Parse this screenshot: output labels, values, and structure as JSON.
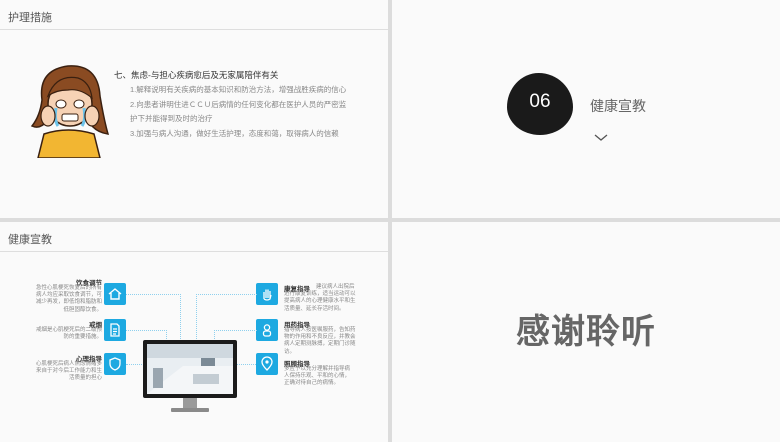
{
  "slide1": {
    "title": "护理措施",
    "heading": "七、焦虑-与担心疾病愈后及无家属陪伴有关",
    "lines": [
      "1.解释说明有关疾病的基本知识和防治方法，增强战胜疾病的信心",
      "2.向患者讲明住进ＣＣＵ后病情的任何变化都在医护人员的严密监",
      "护下并能得到及时的治疗",
      "3.加强与病人沟通，做好生活护理，态度和蔼，取得病人的信赖"
    ]
  },
  "slide2": {
    "number": "06",
    "title": "健康宣教"
  },
  "slide3": {
    "title": "健康宣教",
    "left_items": [
      {
        "title": "饮食调节",
        "body": "急性心肌梗死恢复后的所有\n病人均应采取饮食调节，可\n减少再发，即低饱和脂肪和\n低胆固醇饮食。",
        "icon": "home-icon"
      },
      {
        "title": "戒烟",
        "body": "戒烟是心肌梗死后的二级预\n防的重要措施。",
        "icon": "document-icon"
      },
      {
        "title": "心理指导",
        "body": "心肌梗死后病人焦虑情绪多\n来自于对今后工作能力和生\n活质量的担心",
        "icon": "shield-icon"
      }
    ],
    "right_items": [
      {
        "title": "康复指导",
        "body": "建议病人出院后\n进行康复训练，适当运动可以\n提高病人的心理健康水平和生\n活质量、延长存活时间。",
        "icon": "hand-icon"
      },
      {
        "title": "用药指导",
        "body": "指导病人按医嘱服药，告知药\n物的作用和不良反应，并教会\n病人定期测脉搏，定期门诊随\n访。",
        "icon": "person-icon"
      },
      {
        "title": "照顾指导",
        "body": "多应予以充分理解并指导病\n人保持乐观、平和的心情，\n正确对待自己的病情。",
        "icon": "location-icon"
      }
    ]
  },
  "slide4": {
    "title": "感谢聆听"
  },
  "colors": {
    "accent": "#1da9e1",
    "dark": "#1a1a1a",
    "text_gray": "#888888"
  }
}
